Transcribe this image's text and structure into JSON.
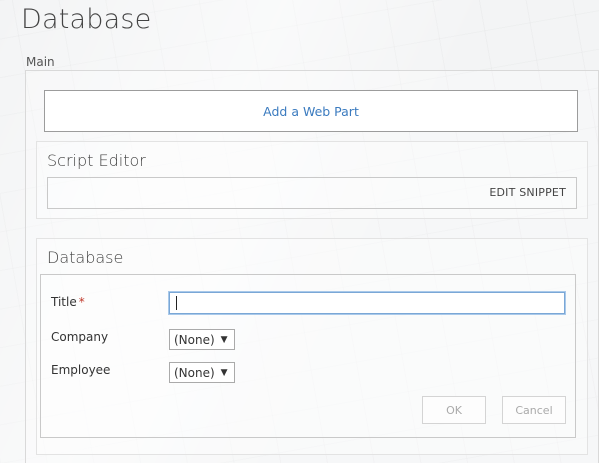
{
  "page": {
    "title": "Database"
  },
  "zone": {
    "label": "Main"
  },
  "add_web_part": {
    "label": "Add a Web Part"
  },
  "script_editor": {
    "title": "Script Editor",
    "edit_snippet_label": "EDIT SNIPPET"
  },
  "database_form": {
    "title": "Database",
    "fields": {
      "title": {
        "label": "Title",
        "required_marker": "*",
        "value": ""
      },
      "company": {
        "label": "Company",
        "selected": "(None)"
      },
      "employee": {
        "label": "Employee",
        "selected": "(None)"
      }
    },
    "ok_label": "OK",
    "cancel_label": "Cancel"
  },
  "colors": {
    "link": "#3b7bbf",
    "required": "#c0392b",
    "input_focus": "#7aa7d6"
  }
}
